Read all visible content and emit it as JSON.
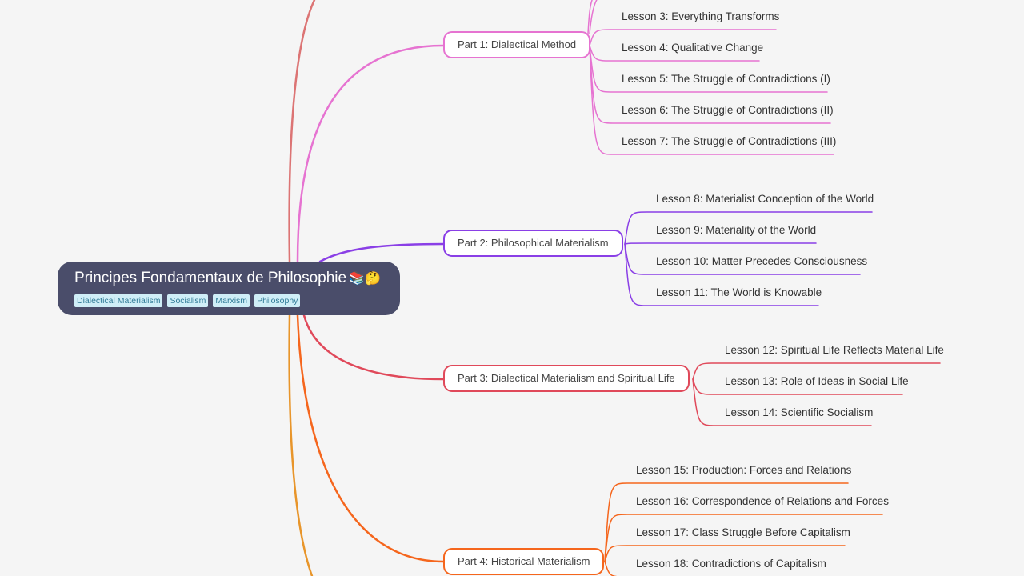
{
  "mindmap": {
    "root": {
      "title": "Principes Fondamentaux de Philosophie",
      "emoji": "📚🤔",
      "tags": [
        "Dialectical Materialism",
        "Socialism",
        "Marxism",
        "Philosophy"
      ]
    },
    "parts": [
      {
        "label": "Part 1: Dialectical Method",
        "color": "#e673d1",
        "lessons": [
          "Lesson 3: Everything Transforms",
          "Lesson 4: Qualitative Change",
          "Lesson 5: The Struggle of Contradictions (I)",
          "Lesson 6: The Struggle of Contradictions (II)",
          "Lesson 7: The Struggle of Contradictions (III)"
        ]
      },
      {
        "label": "Part 2: Philosophical Materialism",
        "color": "#8a3fe6",
        "lessons": [
          "Lesson 8: Materialist Conception of the World",
          "Lesson 9: Materiality of the World",
          "Lesson 10: Matter Precedes Consciousness",
          "Lesson 11: The World is Knowable"
        ]
      },
      {
        "label": "Part 3: Dialectical Materialism and Spiritual Life",
        "color": "#e0495a",
        "lessons": [
          "Lesson 12: Spiritual Life Reflects Material Life",
          "Lesson 13: Role of Ideas in Social Life",
          "Lesson 14: Scientific Socialism"
        ]
      },
      {
        "label": "Part 4: Historical Materialism",
        "color": "#f5661d",
        "lessons": [
          "Lesson 15: Production: Forces and Relations",
          "Lesson 16: Correspondence of Relations and Forces",
          "Lesson 17: Class Struggle Before Capitalism",
          "Lesson 18: Contradictions of Capitalism"
        ]
      }
    ],
    "offscreen_branch_colors": {
      "top": "#dc7474",
      "bottom": "#e8952a"
    }
  }
}
